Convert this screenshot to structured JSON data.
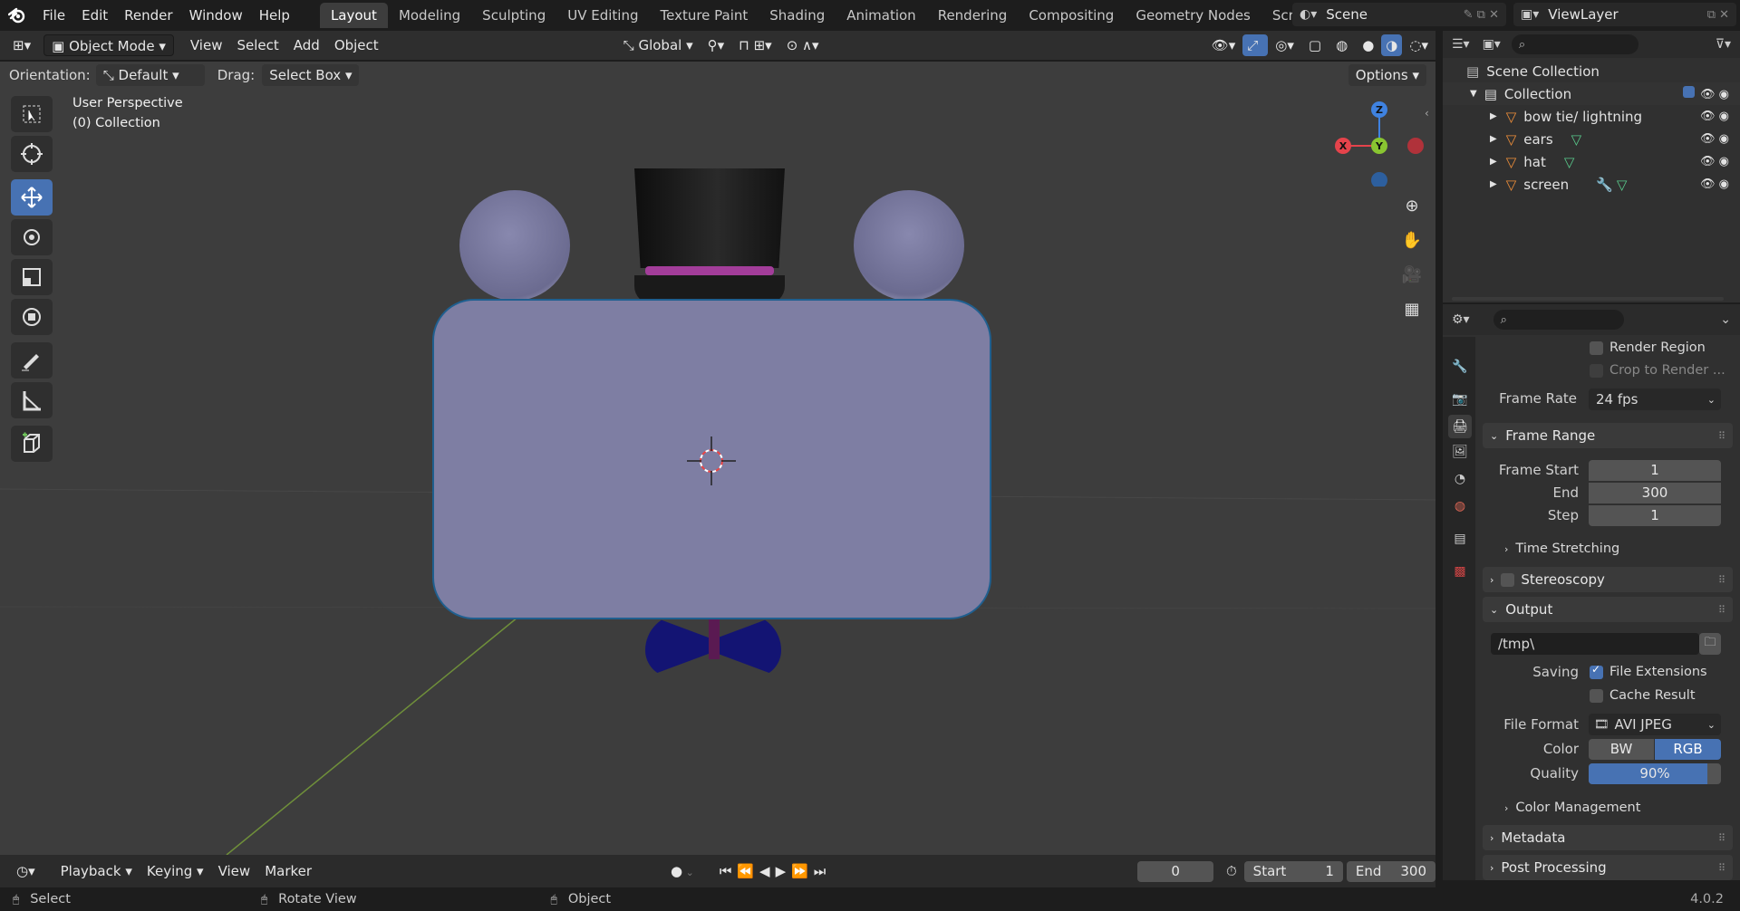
{
  "menu": [
    "File",
    "Edit",
    "Render",
    "Window",
    "Help"
  ],
  "workspaces": [
    "Layout",
    "Modeling",
    "Sculpting",
    "UV Editing",
    "Texture Paint",
    "Shading",
    "Animation",
    "Rendering",
    "Compositing",
    "Geometry Nodes",
    "Scripting"
  ],
  "scene_name": "Scene",
  "view_layer": "ViewLayer",
  "viewport_header": {
    "mode": "Object Mode",
    "view": "View",
    "select": "Select",
    "add": "Add",
    "object": "Object",
    "transform": "Global"
  },
  "tool_settings": {
    "orientation_label": "Orientation:",
    "orientation": "Default",
    "drag_label": "Drag:",
    "drag": "Select Box",
    "options": "Options"
  },
  "viewport_info": {
    "line1": "User Perspective",
    "line2": "(0) Collection"
  },
  "gizmo": {
    "x": "X",
    "y": "Y",
    "z": "Z"
  },
  "outliner": {
    "root": "Scene Collection",
    "collection": "Collection",
    "items": [
      "bow tie/ lightning",
      "ears",
      "hat",
      "screen"
    ]
  },
  "properties": {
    "render_region": "Render Region",
    "crop": "Crop to Render ...",
    "frame_rate_label": "Frame Rate",
    "frame_rate": "24 fps",
    "frame_range": "Frame Range",
    "frame_start_label": "Frame Start",
    "frame_start": "1",
    "end_label": "End",
    "end": "300",
    "step_label": "Step",
    "step": "1",
    "time_stretching": "Time Stretching",
    "stereoscopy": "Stereoscopy",
    "output": "Output",
    "path": "/tmp\\",
    "saving_label": "Saving",
    "file_extensions": "File Extensions",
    "cache_result": "Cache Result",
    "file_format_label": "File Format",
    "file_format": "AVI JPEG",
    "color_label": "Color",
    "color_bw": "BW",
    "color_rgb": "RGB",
    "quality_label": "Quality",
    "quality": "90%",
    "quality_value": 0.9,
    "color_management": "Color Management",
    "metadata": "Metadata",
    "post_processing": "Post Processing"
  },
  "timeline": {
    "playback": "Playback",
    "keying": "Keying",
    "view": "View",
    "marker": "Marker",
    "current": "0",
    "start_label": "Start",
    "start": "1",
    "end_label": "End",
    "end": "300"
  },
  "statusbar": {
    "select": "Select",
    "rotate": "Rotate View",
    "object": "Object",
    "version": "4.0.2"
  },
  "colors": {
    "accent": "#4772b3",
    "viewport": "#3d3d3d",
    "object": "#7e7ea3",
    "axis_x": "#e5434b",
    "axis_y": "#89c531",
    "axis_z": "#3f82e0"
  }
}
